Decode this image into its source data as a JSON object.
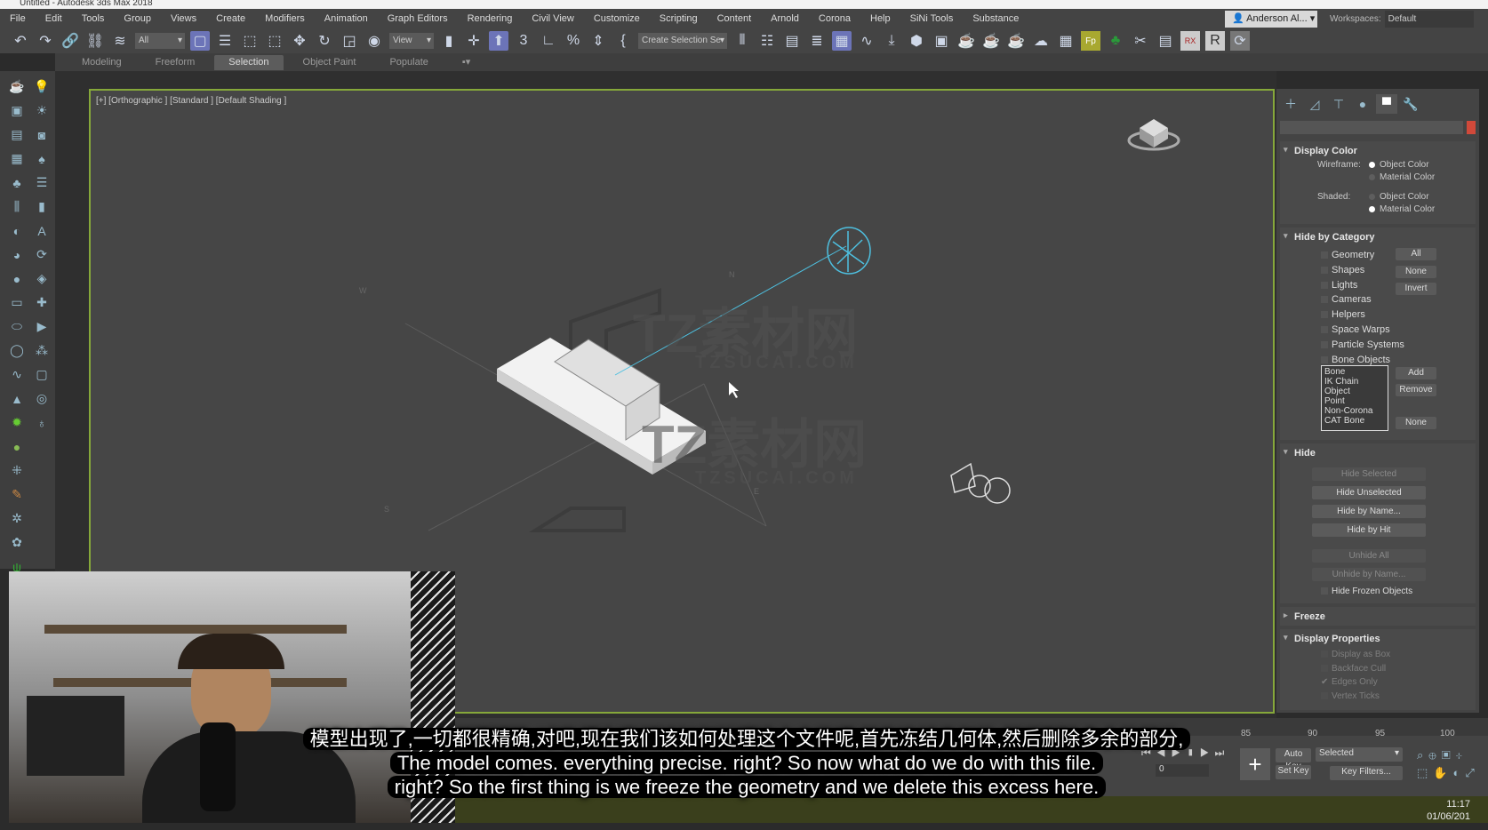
{
  "window": {
    "title": "Untitled - Autodesk 3ds Max 2018"
  },
  "menu": [
    "File",
    "Edit",
    "Tools",
    "Group",
    "Views",
    "Create",
    "Modifiers",
    "Animation",
    "Graph Editors",
    "Rendering",
    "Civil View",
    "Customize",
    "Scripting",
    "Content",
    "Arnold",
    "Corona",
    "Help",
    "SiNi Tools",
    "Substance"
  ],
  "user": {
    "name": "Anderson Al...",
    "workspaces_label": "Workspaces:",
    "workspace": "Default"
  },
  "toolbar": {
    "filter": "All",
    "ref_coord": "View",
    "selection_set": "Create Selection Se"
  },
  "ribbon": {
    "tabs": [
      "Modeling",
      "Freeform",
      "Selection",
      "Object Paint",
      "Populate"
    ],
    "active": "Selection"
  },
  "viewport": {
    "label": "[+] [Orthographic ] [Standard ] [Default Shading ]",
    "watermark_cn": "TZ素材网",
    "watermark_en": "TZSUCAI.COM",
    "compass": [
      "N",
      "W",
      "S",
      "E"
    ]
  },
  "panel": {
    "display_color": {
      "title": "Display Color",
      "wireframe_label": "Wireframe:",
      "shaded_label": "Shaded:",
      "object_color": "Object Color",
      "material_color": "Material Color",
      "wireframe_selected": "Object Color",
      "shaded_selected": "Material Color"
    },
    "hide_by_category": {
      "title": "Hide by Category",
      "items": [
        "Geometry",
        "Shapes",
        "Lights",
        "Cameras",
        "Helpers",
        "Space Warps",
        "Particle Systems",
        "Bone Objects"
      ],
      "all": "All",
      "none": "None",
      "invert": "Invert",
      "list": [
        "Bone",
        "IK Chain Object",
        "Point",
        "Non-Corona",
        "CAT Bone"
      ],
      "add": "Add",
      "remove": "Remove",
      "none2": "None"
    },
    "hide": {
      "title": "Hide",
      "buttons": [
        "Hide Selected",
        "Hide Unselected",
        "Hide by Name...",
        "Hide by Hit",
        "Unhide All",
        "Unhide by Name..."
      ],
      "frozen": "Hide Frozen Objects"
    },
    "freeze": {
      "title": "Freeze"
    },
    "display_properties": {
      "title": "Display Properties",
      "items": [
        "Display as Box",
        "Backface Cull",
        "Edges Only",
        "Vertex Ticks"
      ],
      "checked": "Edges Only"
    }
  },
  "timeline": {
    "ticks": [
      "85",
      "90",
      "95",
      "100"
    ]
  },
  "anim": {
    "frame": "0",
    "auto_key": "Auto Key",
    "set_key": "Set Key",
    "selected": "Selected",
    "key_filters": "Key Filters..."
  },
  "status": {
    "time": "11:17",
    "date": "01/06/201"
  },
  "subtitles": {
    "cn": "模型出现了,一切都很精确,对吧,现在我们该如何处理这个文件呢,首先冻结几何体,然后删除多余的部分,",
    "en1": "The model comes. everything precise. right? So now what do we do with this file.",
    "en2": "right? So the first thing is we freeze the geometry and we delete this excess here."
  }
}
